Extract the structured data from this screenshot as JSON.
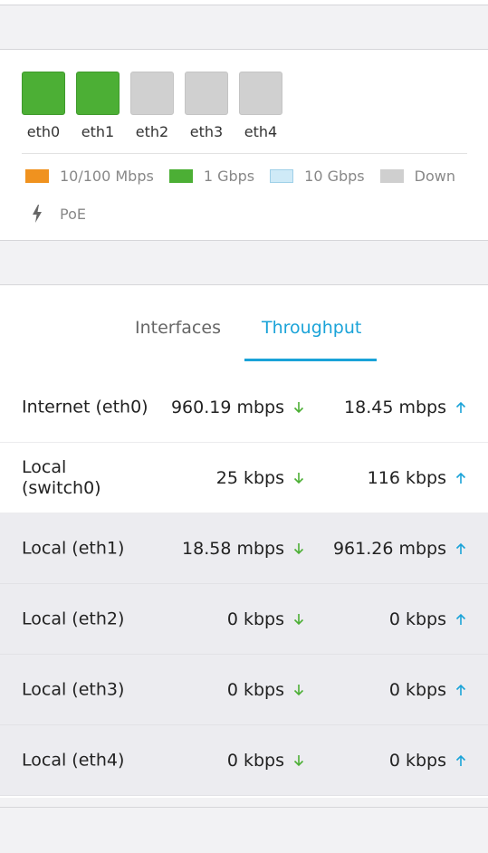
{
  "ports": [
    {
      "label": "eth0",
      "state": "up"
    },
    {
      "label": "eth1",
      "state": "up"
    },
    {
      "label": "eth2",
      "state": "down"
    },
    {
      "label": "eth3",
      "state": "down"
    },
    {
      "label": "eth4",
      "state": "down"
    }
  ],
  "legend": {
    "speed_100": "10/100 Mbps",
    "speed_1g": "1 Gbps",
    "speed_10g": "10 Gbps",
    "down": "Down",
    "poe": "PoE"
  },
  "colors": {
    "orange": "#f0921f",
    "green": "#4caf35",
    "light_blue": "#cfeaf7",
    "grey": "#cfcfcf",
    "accent": "#1aa3d8"
  },
  "tabs": {
    "interfaces": "Interfaces",
    "throughput": "Throughput",
    "active": "throughput"
  },
  "throughput_rows": [
    {
      "name": "Internet (eth0)",
      "rx": "960.19 mbps",
      "tx": "18.45 mbps"
    },
    {
      "name": "Local (switch0)",
      "rx": "25 kbps",
      "tx": "116 kbps"
    },
    {
      "name": "Local (eth1)",
      "rx": "18.58 mbps",
      "tx": "961.26 mbps"
    },
    {
      "name": "Local (eth2)",
      "rx": "0 kbps",
      "tx": "0 kbps"
    },
    {
      "name": "Local (eth3)",
      "rx": "0 kbps",
      "tx": "0 kbps"
    },
    {
      "name": "Local (eth4)",
      "rx": "0 kbps",
      "tx": "0 kbps"
    }
  ]
}
